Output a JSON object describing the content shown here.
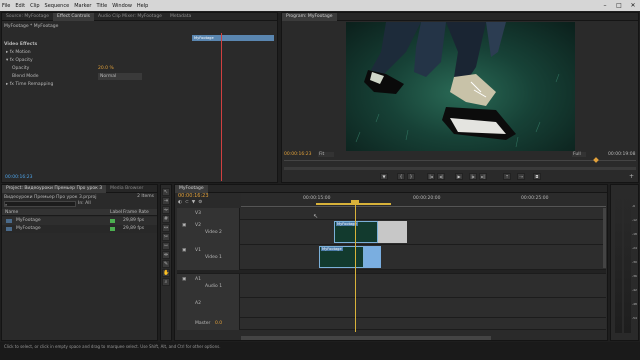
{
  "menu": [
    "File",
    "Edit",
    "Clip",
    "Sequence",
    "Marker",
    "Title",
    "Window",
    "Help"
  ],
  "effects": {
    "tabs": [
      "Source: MyFootage",
      "Effect Controls",
      "Audio Clip Mixer: MyFootage",
      "Metadata"
    ],
    "clip_title": "MyFootage * MyFootage",
    "mini_clip": "MyFootage",
    "section": "Video Effects",
    "motion": "Motion",
    "opacity": "Opacity",
    "opacity_param": "Opacity",
    "opacity_value": "20.0 %",
    "blend_mode": "Blend Mode",
    "blend_value": "Normal",
    "time_remap": "Time Remapping",
    "timecode": "00:00:16:23"
  },
  "program": {
    "tab": "Program: MyFootage",
    "timecode_left": "00:00:16:23",
    "fit": "Fit",
    "quality": "Full",
    "timecode_right": "00:00:19:08"
  },
  "project": {
    "tabs": [
      "Project: Видеоуроки Премьер Про урок 3",
      "Media Browser"
    ],
    "name": "Видеоуроки Премьер Про урок 3.prproj",
    "items_count": "2 Items",
    "in": "In:",
    "in_value": "All",
    "col_name": "Name",
    "col_label": "Label",
    "col_fps": "Frame Rate",
    "rows": [
      {
        "name": "MyFootage",
        "fps": "29,89 fps",
        "color": "#4caf50"
      },
      {
        "name": "MyFootage",
        "fps": "29,89 fps",
        "color": "#4caf50"
      }
    ]
  },
  "timeline": {
    "tab": "MyFootage",
    "timecode": "00:00:16:23",
    "ruler": [
      "00:00:15:00",
      "00:00:20:00",
      "00:00:25:00"
    ],
    "tracks": [
      {
        "id": "V3",
        "name": ""
      },
      {
        "id": "V2",
        "name": "Video 2"
      },
      {
        "id": "V1",
        "name": "Video 1"
      },
      {
        "id": "A1",
        "name": "Audio 1"
      },
      {
        "id": "A2",
        "name": ""
      },
      {
        "id": "Master",
        "name": "Master"
      }
    ],
    "clip_v2": "MyFootage",
    "clip_v1": "MyFootage",
    "master_value": "0.0"
  },
  "status": "Click to select, or click in empty space and drag to marquee select. Use Shift, Alt, and Ctrl for other options.",
  "meter_db": [
    "-6",
    "-12",
    "-18",
    "-24",
    "-30",
    "-36",
    "-42",
    "-48",
    "-54"
  ]
}
